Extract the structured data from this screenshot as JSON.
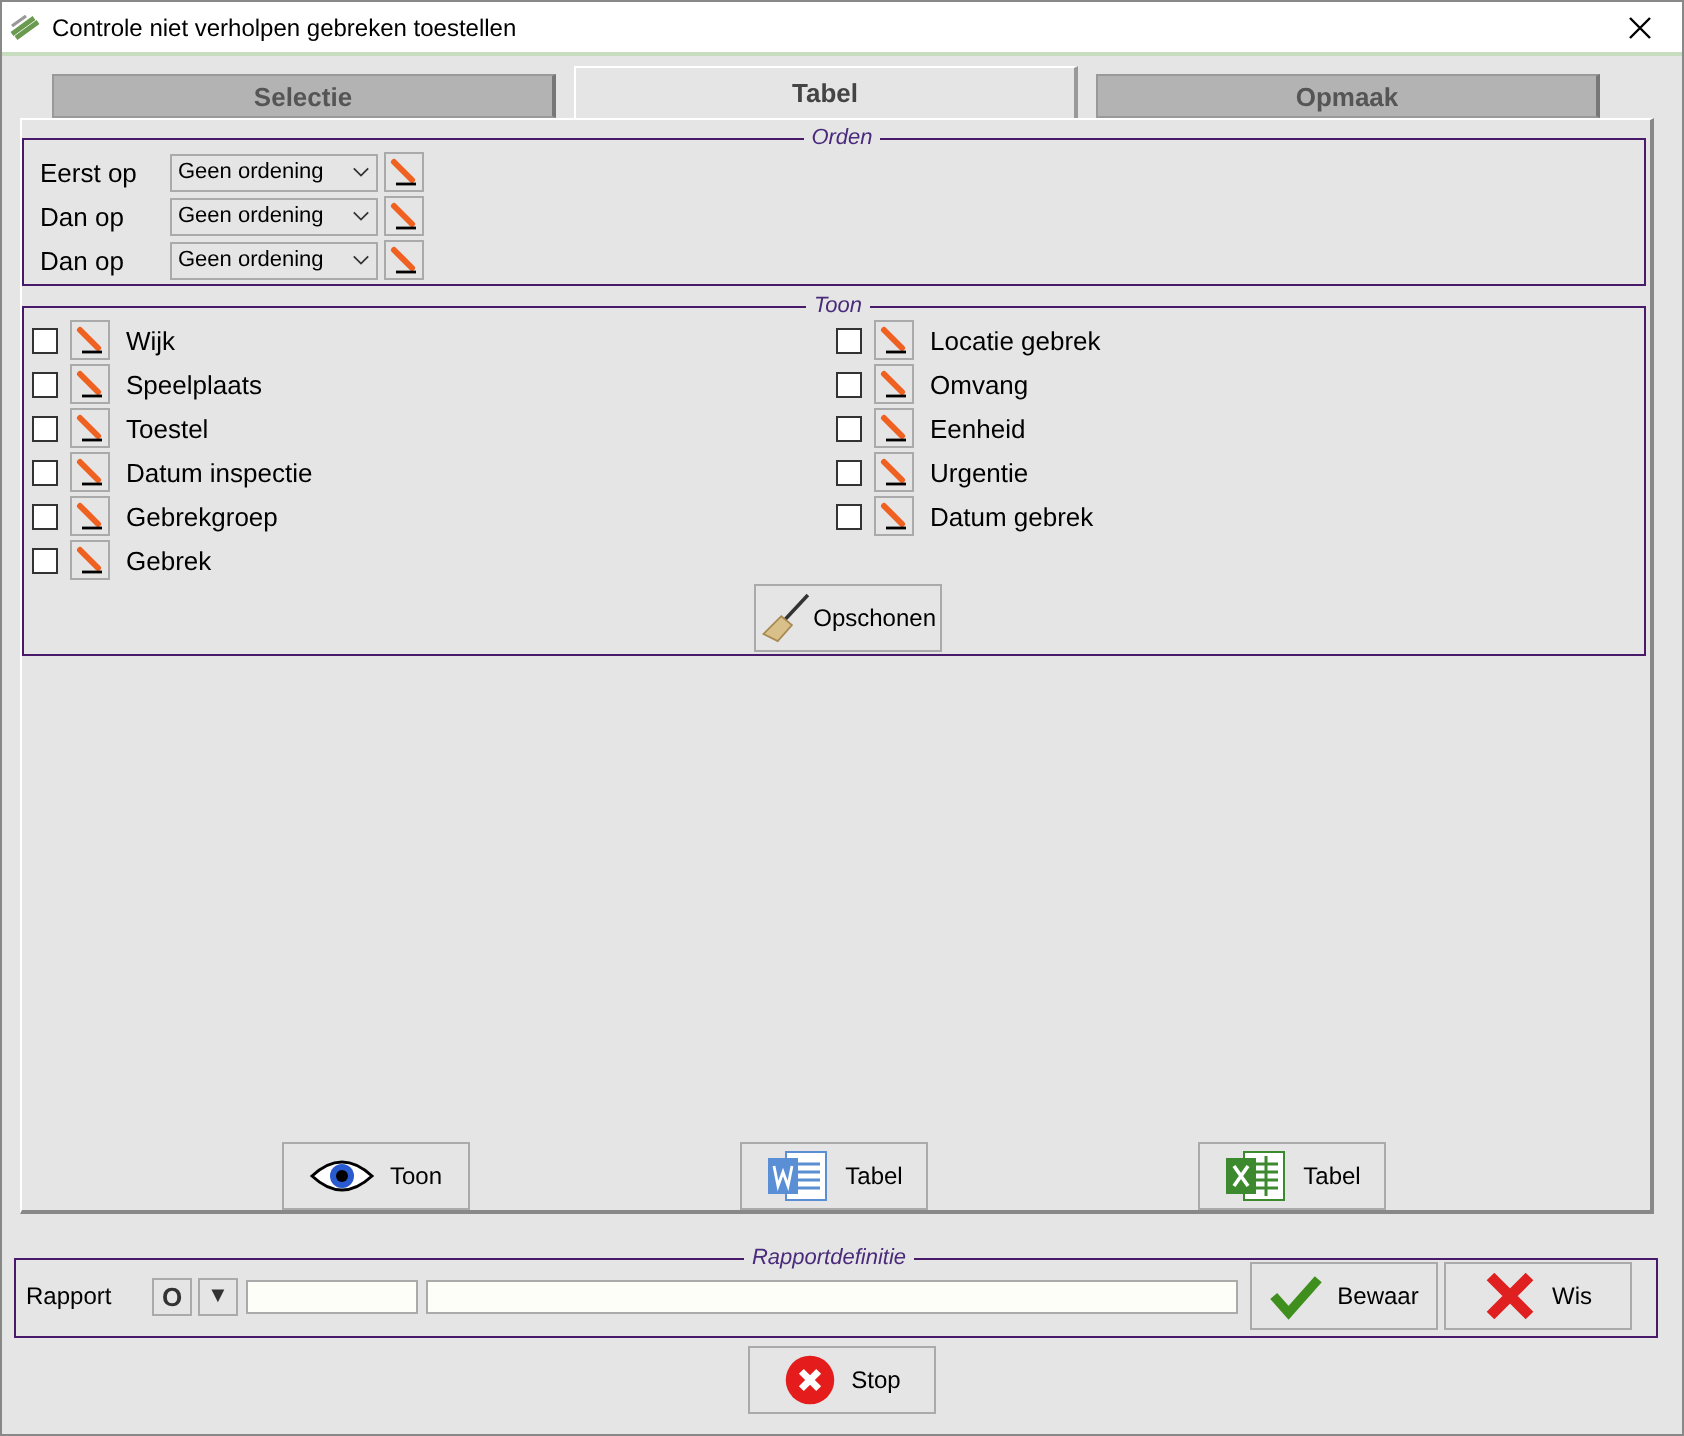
{
  "window": {
    "title": "Controle niet verholpen gebreken toestellen"
  },
  "tabs": [
    {
      "label": "Selectie",
      "selected": false
    },
    {
      "label": "Tabel",
      "selected": true
    },
    {
      "label": "Opmaak",
      "selected": false
    }
  ],
  "orden": {
    "legend": "Orden",
    "rows": [
      {
        "label": "Eerst op",
        "value": "Geen ordening"
      },
      {
        "label": "Dan op",
        "value": "Geen ordening"
      },
      {
        "label": "Dan op",
        "value": "Geen ordening"
      }
    ]
  },
  "toon": {
    "legend": "Toon",
    "fields": [
      {
        "label": "Wijk",
        "checked": false
      },
      {
        "label": "Speelplaats",
        "checked": false
      },
      {
        "label": "Toestel",
        "checked": false
      },
      {
        "label": "Datum inspectie",
        "checked": false
      },
      {
        "label": "Gebrekgroep",
        "checked": false
      },
      {
        "label": "Gebrek",
        "checked": false
      },
      {
        "label": "Locatie gebrek",
        "checked": false
      },
      {
        "label": "Omvang",
        "checked": false
      },
      {
        "label": "Eenheid",
        "checked": false
      },
      {
        "label": "Urgentie",
        "checked": false
      },
      {
        "label": "Datum gebrek",
        "checked": false
      }
    ],
    "clear_button": "Opschonen"
  },
  "output_buttons": [
    {
      "kind": "view",
      "label": "Toon"
    },
    {
      "kind": "word",
      "label": "Tabel"
    },
    {
      "kind": "excel",
      "label": "Tabel"
    }
  ],
  "rapport": {
    "legend": "Rapportdefinitie",
    "label": "Rapport",
    "o_button": "O",
    "dropdown_glyph": "▼",
    "save_button": "Bewaar",
    "delete_button": "Wis"
  },
  "stop_button": "Stop"
}
